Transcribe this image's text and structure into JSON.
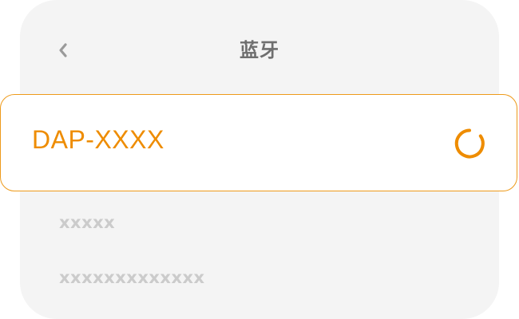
{
  "header": {
    "title": "蓝牙",
    "back_icon": "chevron-left-icon"
  },
  "selected_device": {
    "name": "DAP-XXXX",
    "status_icon": "loading-spinner-icon"
  },
  "device_list": [
    {
      "name": "xxxxx"
    },
    {
      "name": "xxxxxxxxxxxxx"
    }
  ],
  "colors": {
    "accent": "#ee8c00",
    "panel_bg": "#f4f4f4",
    "muted_text": "#cbcbcb",
    "title_text": "#6f6f6f"
  }
}
